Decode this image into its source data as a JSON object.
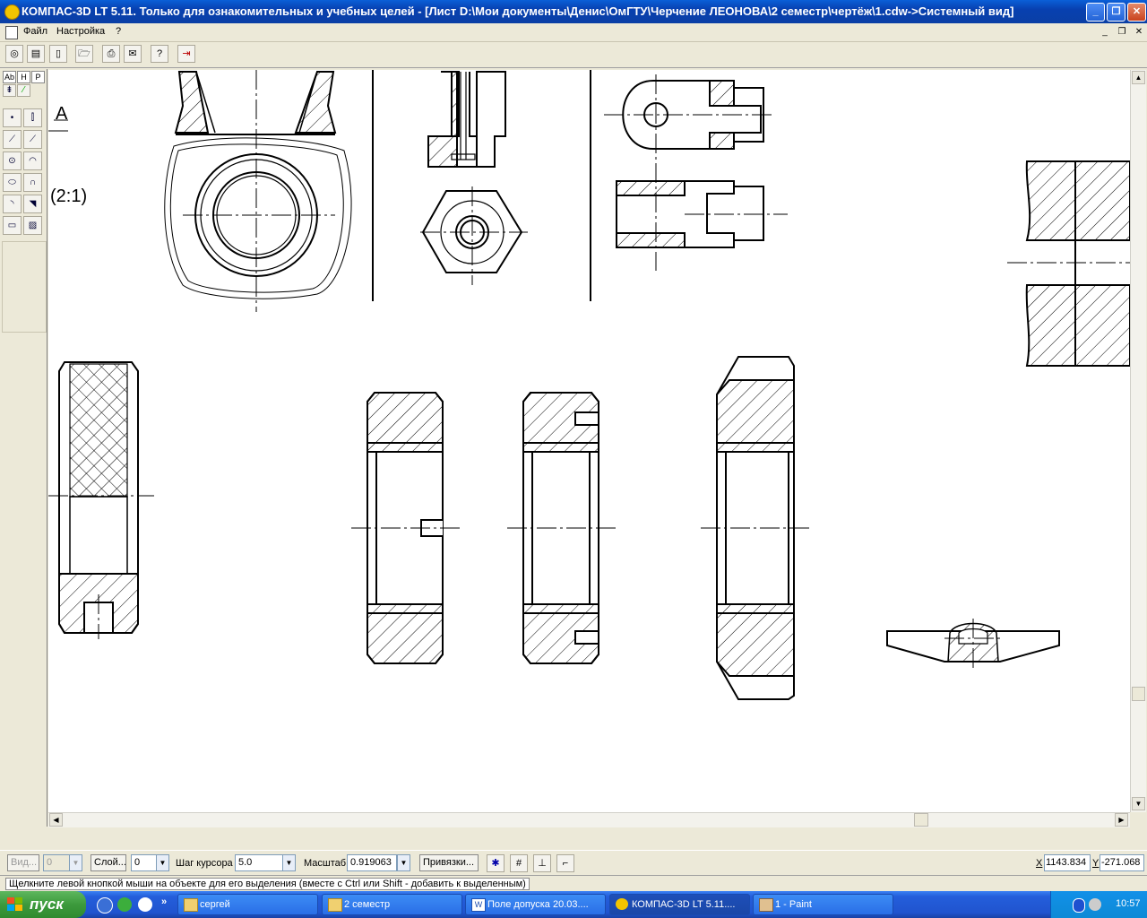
{
  "window": {
    "title": "КОМПАС-3D LT 5.11. Только для ознакомительных и учебных целей - [Лист D:\\Мои документы\\Денис\\ОмГТУ\\Черчение ЛЕОНОВА\\2 семестр\\чертёж\\1.cdw->Системный вид]",
    "minimize": "_",
    "maximize": "❐",
    "close": "✕"
  },
  "menu": {
    "items": [
      "Файл",
      "Настройка",
      "?"
    ],
    "mdi_minimize": "_",
    "mdi_restore": "❐",
    "mdi_close": "✕"
  },
  "palette": {
    "tabs": [
      "Ab",
      "H",
      "P"
    ]
  },
  "drawing": {
    "label_view": "A",
    "label_scale": "(2:1)"
  },
  "props": {
    "view_label": "Вид...",
    "view_value": "0",
    "layer_label": "Слой...",
    "layer_value": "0",
    "step_label": "Шаг курсора",
    "step_value": "5.0",
    "scale_label": "Масштаб",
    "scale_value": "0.919063",
    "snaps_label": "Привязки...",
    "x_label": "X",
    "x_value": "1143.834",
    "y_label": "Y",
    "y_value": "-271.068"
  },
  "status_message": "Щелкните левой кнопкой мыши на объекте для его выделения (вместе с Ctrl или Shift - добавить к выделенным)",
  "taskbar": {
    "start_label": "пуск",
    "more": "»",
    "tasks": [
      {
        "label": "сергей",
        "icon": "folder-icon"
      },
      {
        "label": "2 семестр",
        "icon": "folder-icon"
      },
      {
        "label": "Поле допуска 20.03....",
        "icon": "word-icon"
      },
      {
        "label": "КОМПАС-3D LT 5.11....",
        "icon": "kompas-icon",
        "active": true
      },
      {
        "label": "1 - Paint",
        "icon": "paint-icon"
      }
    ],
    "clock": "10:57"
  }
}
